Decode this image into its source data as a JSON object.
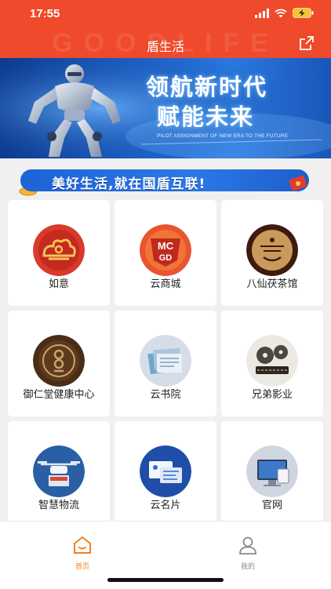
{
  "status": {
    "time": "17:55"
  },
  "nav": {
    "title": "盾生活",
    "bg_text": "GOODLIFE"
  },
  "banner": {
    "line1": "领航新时代",
    "line2": "赋能未来",
    "subtitle": "PILOT ASSIGNMENT OF NEW ERA TO THE FUTURE"
  },
  "ribbon": {
    "text": "美好生活,就在国盾互联!"
  },
  "grid": {
    "items": [
      {
        "label": "如意",
        "icon": "ruyi-cloud-icon"
      },
      {
        "label": "云商城",
        "icon": "mall-logo-icon"
      },
      {
        "label": "八仙茯茶馆",
        "icon": "tea-house-icon"
      },
      {
        "label": "御仁堂健康中心",
        "icon": "health-center-icon"
      },
      {
        "label": "云书院",
        "icon": "books-icon"
      },
      {
        "label": "兄弟影业",
        "icon": "film-reel-icon"
      },
      {
        "label": "智慧物流",
        "icon": "drone-icon"
      },
      {
        "label": "云名片",
        "icon": "business-card-icon"
      },
      {
        "label": "官网",
        "icon": "website-icon"
      }
    ]
  },
  "tabbar": {
    "home_label": "首页",
    "mine_label": "我的",
    "active_color": "#f0801c"
  },
  "colors": {
    "brand_red": "#ef4a2b",
    "accent_blue": "#1d63d8"
  }
}
